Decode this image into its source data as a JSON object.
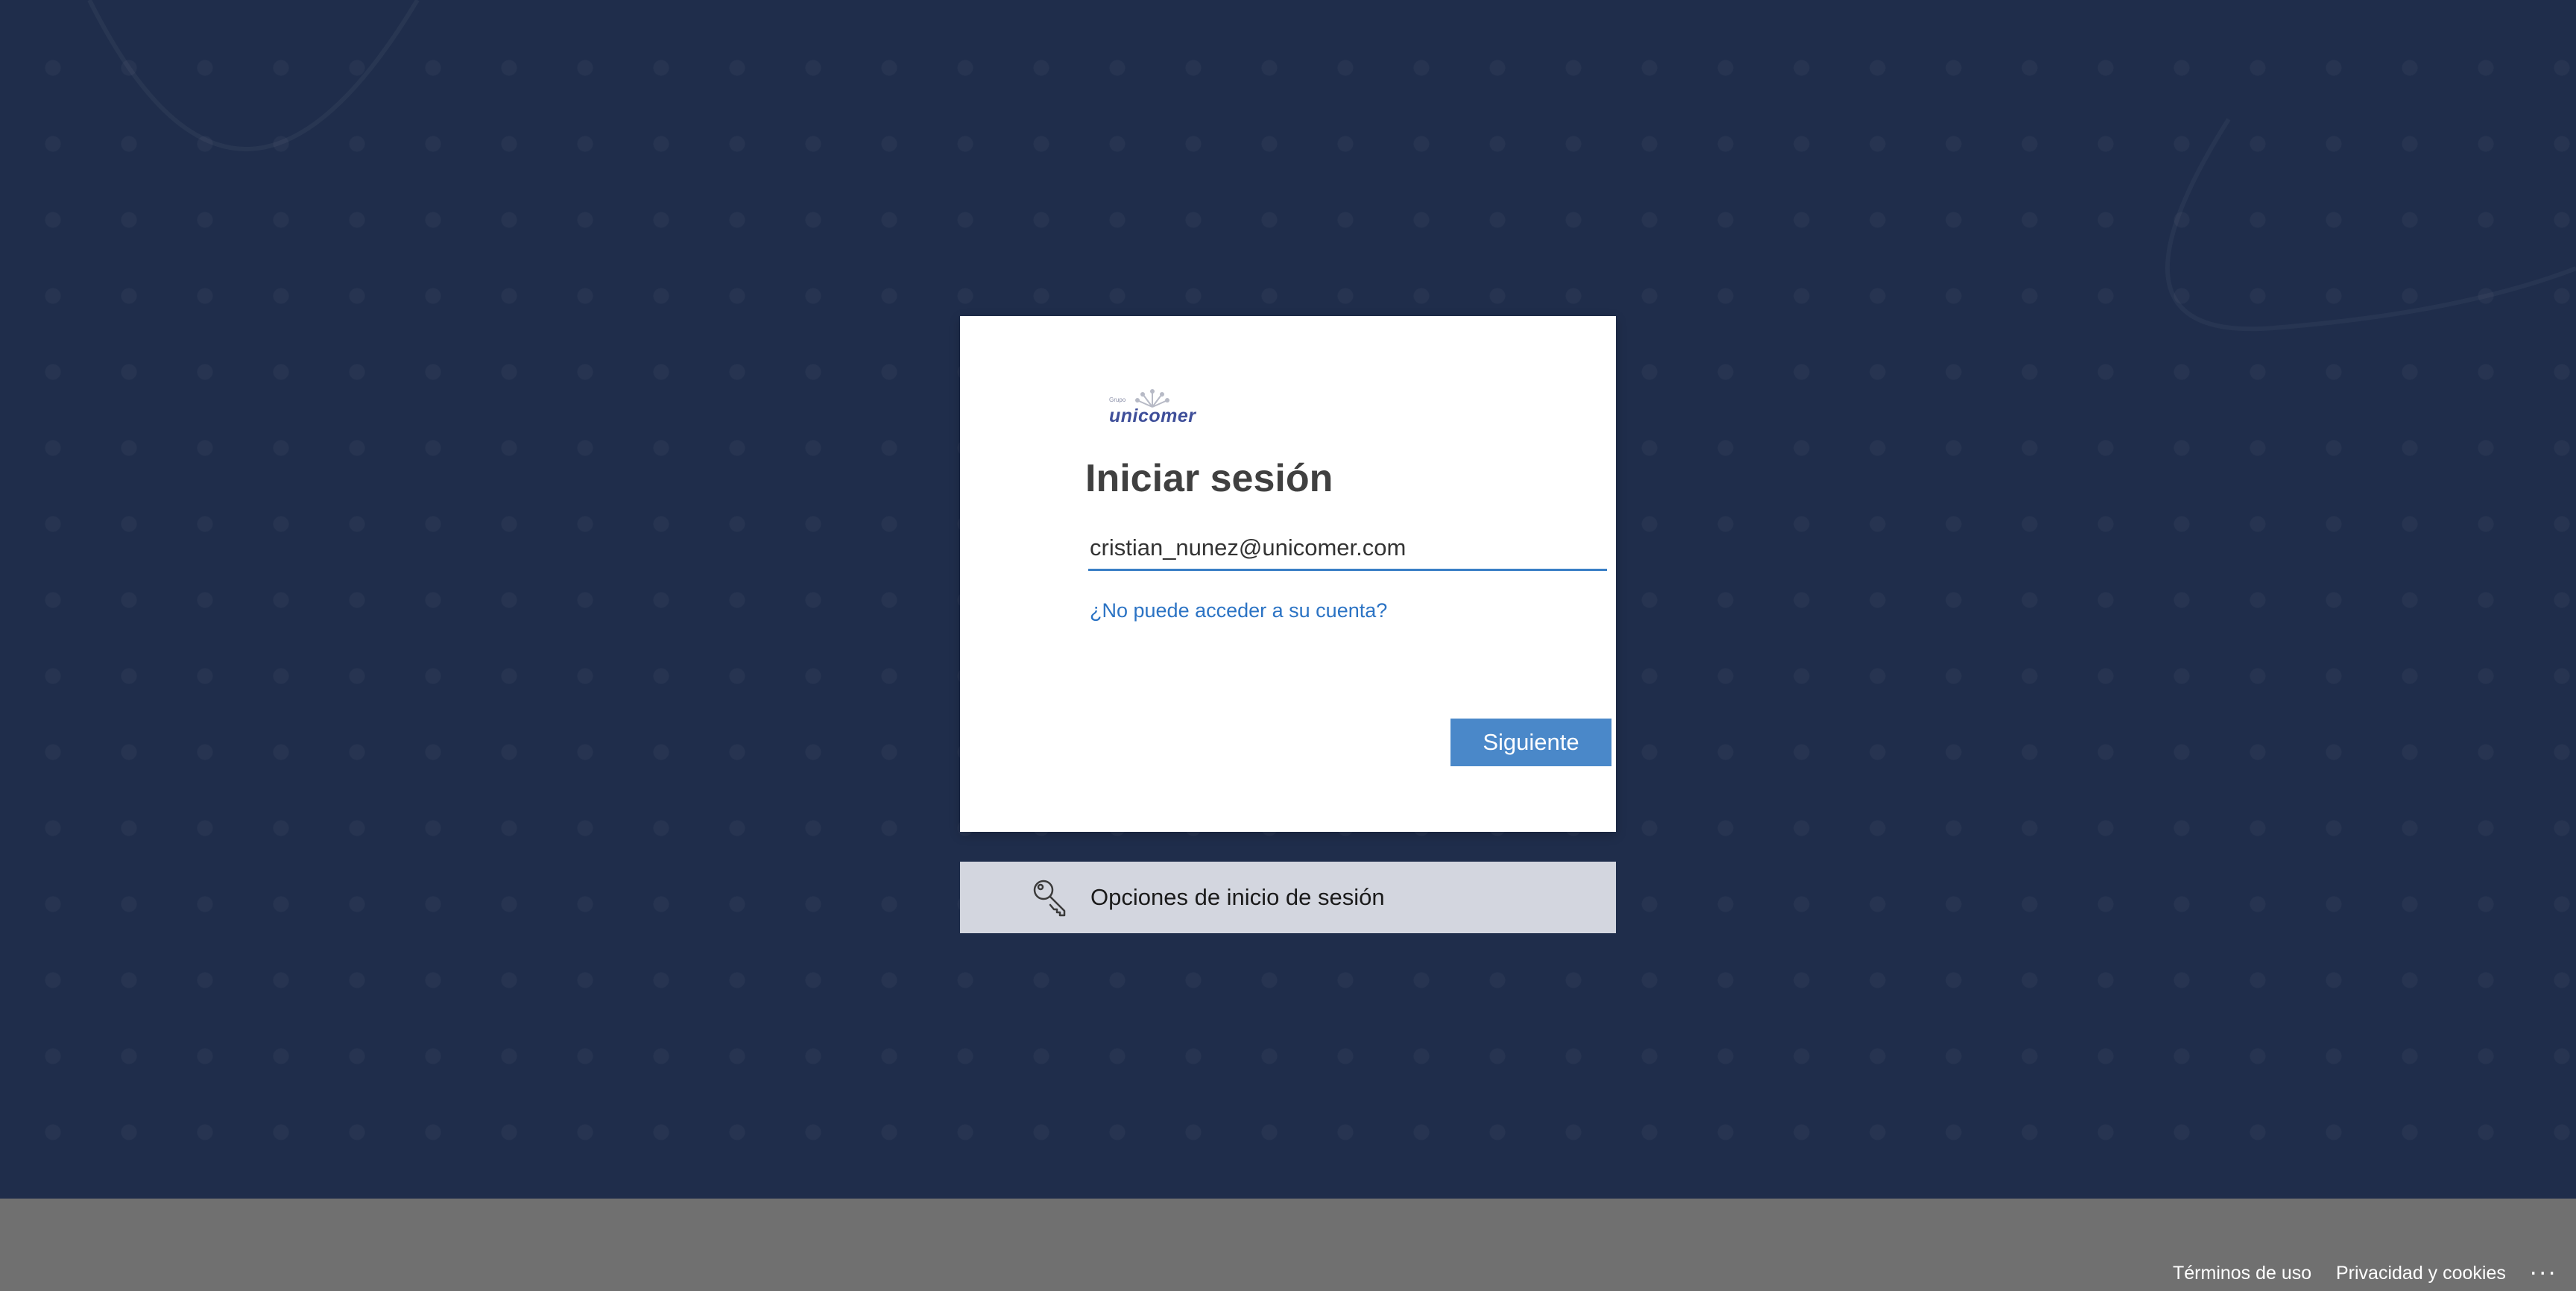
{
  "login": {
    "logo_text": "unicomer",
    "logo_small_text": "Grupo",
    "title": "Iniciar sesión",
    "email_value": "cristian_nunez@unicomer.com",
    "cant_access_link": "¿No puede acceder a su cuenta?",
    "next_button": "Siguiente"
  },
  "signin_options": {
    "label": "Opciones de inicio de sesión",
    "icon": "key-icon"
  },
  "footer": {
    "terms": "Términos de uso",
    "privacy": "Privacidad y cookies",
    "more": "..."
  },
  "colors": {
    "background": "#1f2d4b",
    "accent": "#4a88c9",
    "link": "#2b73c4",
    "footer": "#707070",
    "options_panel": "#d3d6df"
  }
}
